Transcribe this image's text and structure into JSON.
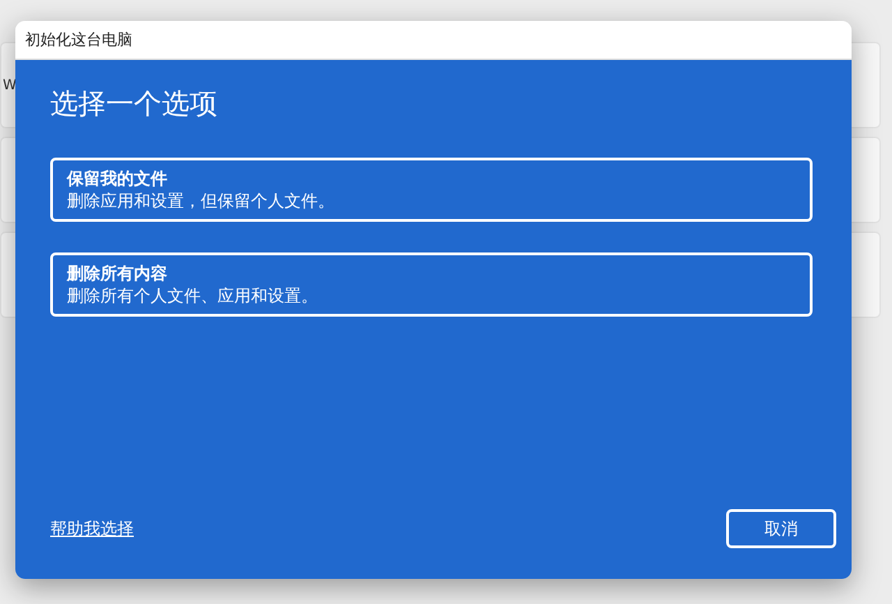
{
  "background": {
    "card_label": "W"
  },
  "dialog": {
    "title": "初始化这台电脑",
    "heading": "选择一个选项",
    "options": [
      {
        "title": "保留我的文件",
        "description": "删除应用和设置，但保留个人文件。"
      },
      {
        "title": "删除所有内容",
        "description": "删除所有个人文件、应用和设置。"
      }
    ],
    "help_link": "帮助我选择",
    "cancel_button": "取消"
  }
}
